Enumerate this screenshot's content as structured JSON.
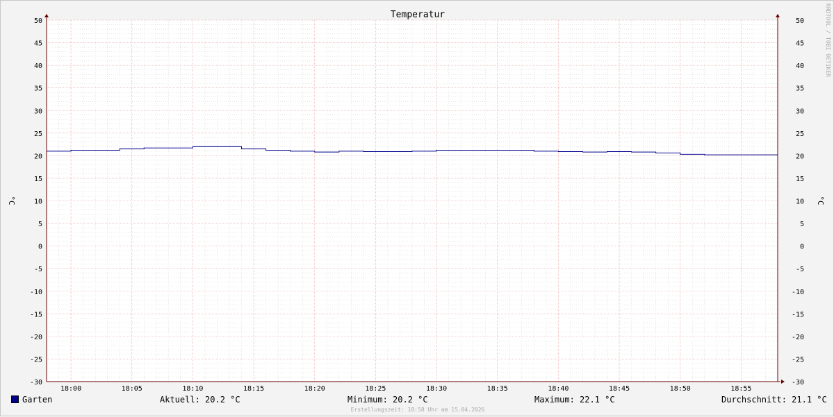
{
  "chart_data": {
    "type": "line",
    "title": "Temperatur",
    "ylabel": "°C",
    "ylabel_right": "°C",
    "ylim": [
      -30,
      50
    ],
    "yticks": [
      50,
      45,
      40,
      35,
      30,
      25,
      20,
      15,
      10,
      5,
      0,
      -5,
      -10,
      -15,
      -20,
      -25,
      -30
    ],
    "xlim": [
      "17:58",
      "18:58"
    ],
    "xticks": [
      "18:00",
      "18:05",
      "18:10",
      "18:15",
      "18:20",
      "18:25",
      "18:30",
      "18:35",
      "18:40",
      "18:45",
      "18:50",
      "18:55"
    ],
    "grid": true,
    "colors": {
      "series": "#00008b",
      "grid_major": "#e8a0a0",
      "grid_minor": "#cfcfcf",
      "axis": "#6b0000"
    },
    "series": [
      {
        "name": "Garten",
        "points": [
          [
            "17:58",
            21.0
          ],
          [
            "18:00",
            21.2
          ],
          [
            "18:04",
            21.5
          ],
          [
            "18:06",
            21.7
          ],
          [
            "18:10",
            22.0
          ],
          [
            "18:14",
            21.5
          ],
          [
            "18:16",
            21.2
          ],
          [
            "18:18",
            21.0
          ],
          [
            "18:20",
            20.8
          ],
          [
            "18:22",
            21.0
          ],
          [
            "18:24",
            20.9
          ],
          [
            "18:28",
            21.0
          ],
          [
            "18:30",
            21.2
          ],
          [
            "18:38",
            21.0
          ],
          [
            "18:40",
            20.9
          ],
          [
            "18:42",
            20.8
          ],
          [
            "18:44",
            20.9
          ],
          [
            "18:46",
            20.8
          ],
          [
            "18:48",
            20.6
          ],
          [
            "18:50",
            20.3
          ],
          [
            "18:52",
            20.2
          ],
          [
            "18:58",
            20.2
          ]
        ]
      }
    ]
  },
  "legend": {
    "series_name": "Garten",
    "current": "Aktuell: 20.2 °C",
    "minimum": "Minimum: 20.2 °C",
    "maximum": "Maximum: 22.1 °C",
    "average": "Durchschnitt: 21.1 °C"
  },
  "footer": "Erstellungszeit: 18:58 Uhr am 15.04.2026",
  "watermark": "RRDTOOL / TOBI OETIKER"
}
